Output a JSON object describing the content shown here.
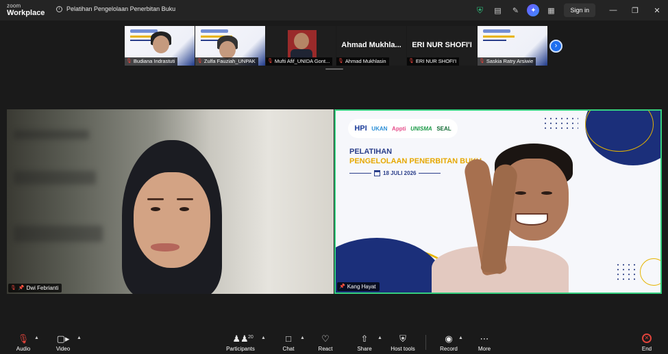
{
  "app": {
    "logo_line1": "zoom",
    "logo_line2": "Workplace",
    "meeting_title": "Pelatihan Pengelolaan Penerbitan Buku",
    "sign_in_label": "Sign in"
  },
  "thumbnails": [
    {
      "name": "Budiana Indrastuti",
      "muted": true
    },
    {
      "name": "Zulfa Fauziah_UNPAK",
      "muted": true
    },
    {
      "name": "Mufti Afif_UNIDA Gont...",
      "muted": true
    },
    {
      "name": "Ahmad Mukhlasin",
      "display": "Ahmad Mukhla...",
      "muted": true
    },
    {
      "name": "ERI NUR SHOFI'I",
      "display": "ERI NUR SHOFI'I",
      "muted": true
    },
    {
      "name": "Saskia Ratry Arsiwie",
      "muted": true
    }
  ],
  "main_tiles": {
    "left": {
      "name": "Dwi Febrianti",
      "muted": true,
      "pinned": true
    },
    "right": {
      "name": "Kang Hayat",
      "pinned": true
    }
  },
  "slide": {
    "logos": [
      "HPI",
      "UKAN",
      "Appti",
      "UNISMA",
      "SEAL"
    ],
    "title_line1": "PELATIHAN",
    "title_line2": "PENGELOLAAN PENERBITAN BUKU",
    "date": "18 JULI 2026"
  },
  "toolbar": {
    "audio": "Audio",
    "video": "Video",
    "participants": "Participants",
    "participants_count": "20",
    "chat": "Chat",
    "react": "React",
    "share": "Share",
    "host_tools": "Host tools",
    "record": "Record",
    "more": "More",
    "end": "End"
  },
  "colors": {
    "active_speaker_border": "#35d07f",
    "accent_blue": "#1e6ff0",
    "muted_red": "#e0433b",
    "slide_navy": "#2a3e8a",
    "slide_gold": "#e6a800"
  }
}
